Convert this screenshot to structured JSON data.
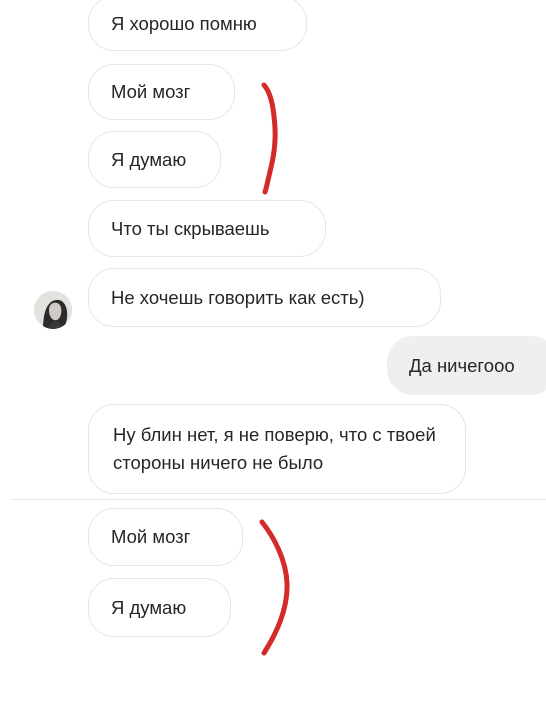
{
  "conversation": {
    "messages": [
      {
        "id": "m1",
        "direction": "incoming",
        "text": "Я хорошо помню"
      },
      {
        "id": "m2",
        "direction": "incoming",
        "text": "Мой мозг"
      },
      {
        "id": "m3",
        "direction": "incoming",
        "text": "Я думаю"
      },
      {
        "id": "m4",
        "direction": "incoming",
        "text": "Что ты скрываешь"
      },
      {
        "id": "m5",
        "direction": "incoming",
        "text": "Не хочешь говорить как есть)"
      },
      {
        "id": "m6",
        "direction": "outgoing",
        "text": "Да ничегооо"
      },
      {
        "id": "m7",
        "direction": "incoming",
        "text": "Ну блин нет, я не поверю, что с твоей стороны ничего не было"
      },
      {
        "id": "m8",
        "direction": "incoming",
        "text": "Мой мозг"
      },
      {
        "id": "m9",
        "direction": "incoming",
        "text": "Я думаю"
      }
    ]
  },
  "colors": {
    "bubble_border": "#e6e6e6",
    "outgoing_bubble": "#efefef",
    "text": "#262626",
    "annotation_red": "#d42a2a"
  },
  "icons": {
    "avatar": "contact-avatar",
    "annotation": "red-hand-drawn-bracket"
  }
}
